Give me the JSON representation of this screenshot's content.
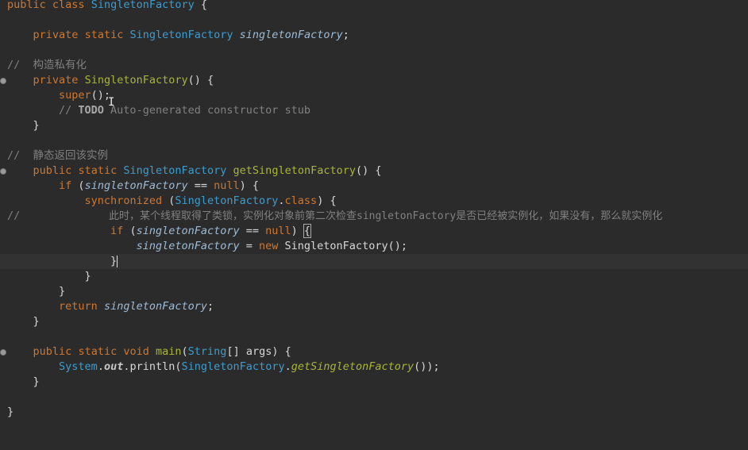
{
  "tokens": {
    "public": "public",
    "private": "private",
    "static": "static",
    "class": "class",
    "void": "void",
    "if": "if",
    "new": "new",
    "null": "null",
    "return": "return",
    "super": "super",
    "synchronized": "synchronized",
    "class_lit": "class",
    "class_name": "SingletonFactory",
    "field_name": "singletonFactory",
    "method_get": "getSingletonFactory",
    "method_main": "main",
    "string_type": "String",
    "args": "args",
    "system": "System",
    "out": "out",
    "println": "println"
  },
  "comments": {
    "private_ctor": "//  构造私有化",
    "todo_tag": "TODO",
    "todo_text": " Auto-generated constructor stub",
    "static_return": "//  静态返回该实例",
    "double_check_prefix": "//",
    "double_check_text": "此时，某个线程取得了类锁，实例化对象前第二次检查singletonFactory是否已经被实例化，如果没有，那么就实例化"
  },
  "colors": {
    "background": "#2b2b2b",
    "keyword": "#cc7832",
    "type": "#3d9ccf",
    "field": "#9dbbd6",
    "method": "#a9b53a",
    "comment": "#808080",
    "current_line": "#323232"
  }
}
